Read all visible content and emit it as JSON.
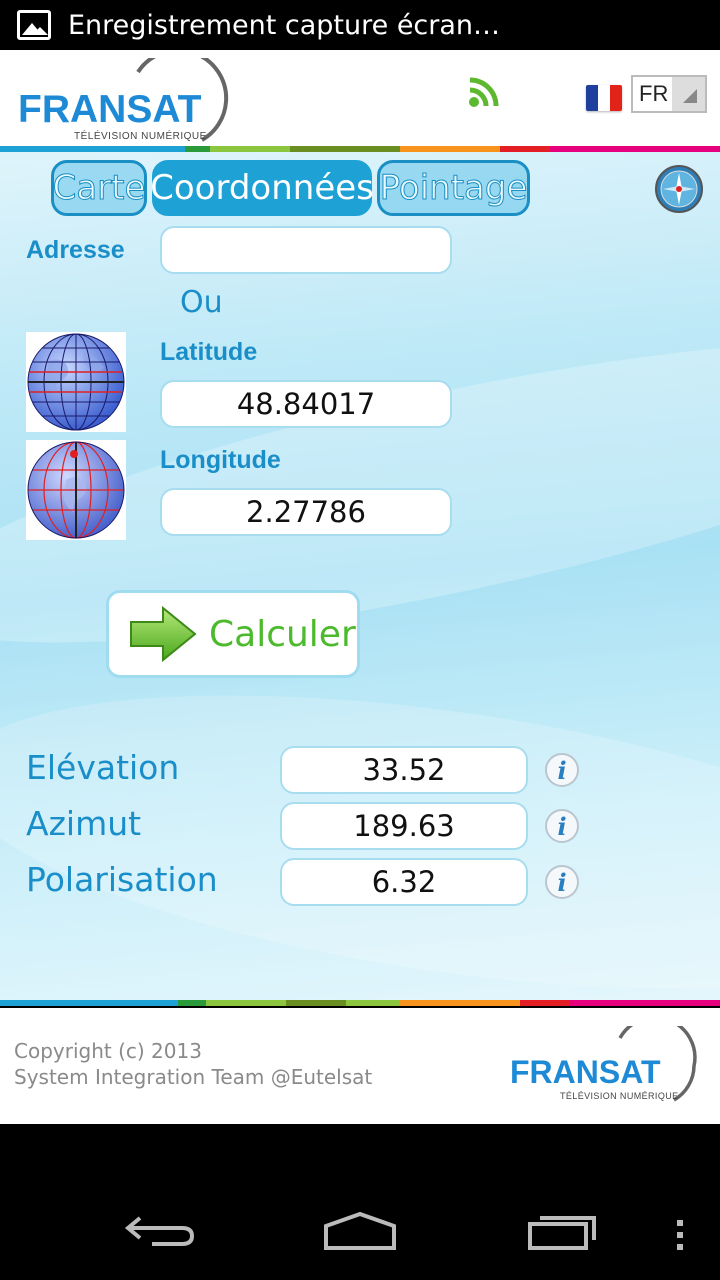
{
  "status_bar": {
    "notification_text": "Enregistrement capture écran…",
    "notification_icon": "picture-icon"
  },
  "header": {
    "logo_text": "FRANSAT",
    "logo_subtitle": "TÉLÉVISION NUMÉRIQUE",
    "rss_icon": "rss-icon",
    "language_flag": "france-flag-icon",
    "language_value": "FR"
  },
  "tabs": [
    {
      "label": "Carte",
      "active": false
    },
    {
      "label": "Coordonnées",
      "active": true
    },
    {
      "label": "Pointage",
      "active": false
    }
  ],
  "form": {
    "address_label": "Adresse",
    "address_value": "",
    "or_label": "Ou",
    "latitude_label": "Latitude",
    "latitude_value": "48.84017",
    "longitude_label": "Longitude",
    "longitude_value": "2.27786",
    "calculate_label": "Calculer"
  },
  "results": [
    {
      "label": "Elévation",
      "value": "33.52"
    },
    {
      "label": "Azimut",
      "value": "189.63"
    },
    {
      "label": "Polarisation",
      "value": "6.32"
    }
  ],
  "footer": {
    "copyright_line1": "Copyright (c) 2013",
    "copyright_line2": "System Integration Team @Eutelsat",
    "logo_text": "FRANSAT",
    "logo_subtitle": "TÉLÉVISION NUMÉRIQUE"
  },
  "colors": {
    "accent_blue": "#1a8ec8",
    "calc_green": "#4cba2c",
    "stripe": [
      "#1ea2d6",
      "#2b9a3a",
      "#8cc63f",
      "#f7941d",
      "#e31e24",
      "#e6007e"
    ]
  }
}
